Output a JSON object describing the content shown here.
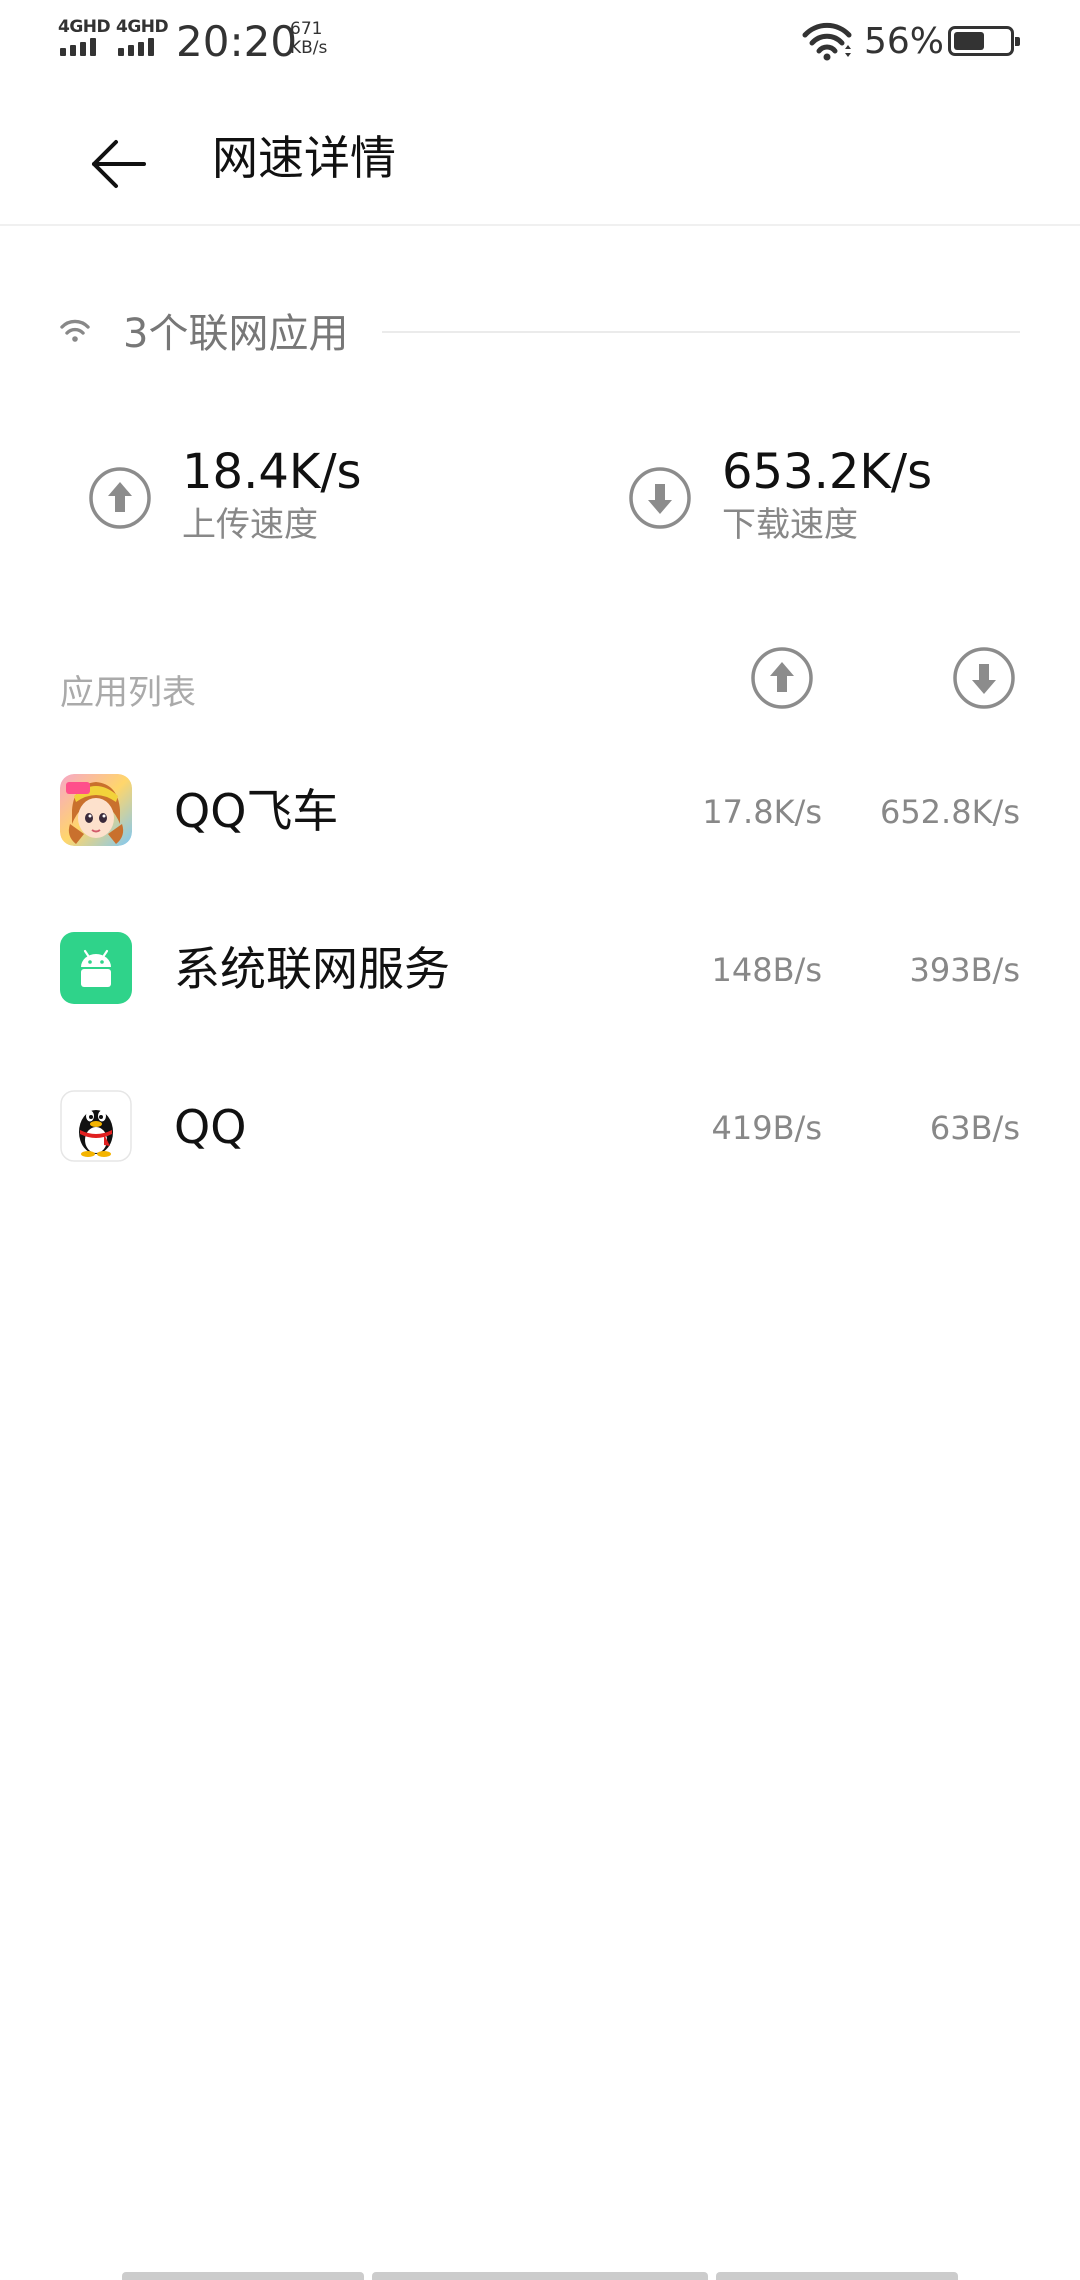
{
  "status_bar": {
    "sim1_label": "4GHD",
    "sim2_label": "4GHD",
    "time": "20:20",
    "net_speed_value": "671",
    "net_speed_unit": "KB/s",
    "battery_percent": "56%",
    "battery_level": 0.56,
    "signal_icon": "cell-signal-icon",
    "wifi_icon": "wifi-icon",
    "battery_icon": "battery-icon"
  },
  "app_bar": {
    "back_icon": "arrow-left-icon",
    "title": "网速详情"
  },
  "summary": {
    "connected_apps_label": "3个联网应用",
    "wifi_icon": "wifi-icon",
    "upload": {
      "icon": "upload-circle-icon",
      "value": "18.4K/s",
      "label": "上传速度"
    },
    "download": {
      "icon": "download-circle-icon",
      "value": "653.2K/s",
      "label": "下载速度"
    }
  },
  "app_list": {
    "header": "应用列表",
    "upload_column_icon": "upload-circle-icon",
    "download_column_icon": "download-circle-icon",
    "apps": [
      {
        "name": "QQ飞车",
        "icon": "qq-speed-app-icon",
        "upload": "17.8K/s",
        "download": "652.8K/s"
      },
      {
        "name": "系统联网服务",
        "icon": "android-app-icon",
        "upload": "148B/s",
        "download": "393B/s"
      },
      {
        "name": "QQ",
        "icon": "qq-penguin-app-icon",
        "upload": "419B/s",
        "download": "63B/s"
      }
    ]
  },
  "colors": {
    "android_green": "#2fd38a",
    "icon_gray": "#8c8c8c",
    "secondary_text": "#888888"
  }
}
